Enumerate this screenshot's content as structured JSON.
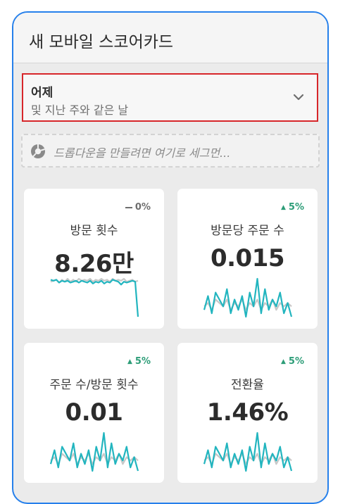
{
  "header": {
    "title": "새 모바일 스코어카드"
  },
  "date_range": {
    "label": "어제",
    "sublabel": "및 지난 주와 같은 날"
  },
  "dropzone": {
    "placeholder": "드롭다운을 만들려면 여기로 세그먼..."
  },
  "colors": {
    "accent": "#2680eb",
    "selection_border": "#d7262a",
    "positive": "#2d9d78",
    "current_series": "#22b5bf",
    "previous_series": "#c8c8c8"
  },
  "metrics": [
    {
      "name": "방문 횟수",
      "value": "8.26만",
      "delta": "0%",
      "trend": "flat",
      "current": [
        8,
        7,
        8,
        5,
        7,
        6,
        7,
        5,
        6,
        7,
        5,
        7,
        6,
        5,
        7,
        4,
        6,
        5,
        7,
        4,
        6,
        5,
        8,
        7,
        6,
        3,
        6,
        5,
        6,
        7,
        6,
        -30
      ],
      "previous": [
        6,
        7,
        8,
        5,
        8,
        6,
        9,
        6,
        8,
        6,
        9,
        7,
        8,
        7,
        9,
        6,
        8,
        7,
        9,
        7,
        8,
        6,
        9,
        7,
        8,
        7,
        9,
        6,
        7,
        8,
        6,
        7
      ]
    },
    {
      "name": "방문당 주문 수",
      "value": "0.015",
      "delta": "5%",
      "trend": "up",
      "current": [
        3,
        7,
        2,
        8,
        6,
        4,
        9,
        2,
        6,
        3,
        7,
        1,
        8,
        4,
        12,
        2,
        9,
        3,
        6,
        4,
        8,
        2,
        5,
        1
      ],
      "previous": [
        4,
        5,
        3,
        6,
        5,
        4,
        6,
        3,
        5,
        4,
        6,
        3,
        5,
        4,
        6,
        3,
        5,
        4,
        6,
        3,
        5,
        4,
        5,
        4
      ]
    },
    {
      "name": "주문 수/방문 횟수",
      "value": "0.01",
      "delta": "5%",
      "trend": "up",
      "current": [
        3,
        7,
        2,
        8,
        6,
        4,
        9,
        2,
        6,
        3,
        7,
        1,
        8,
        4,
        12,
        2,
        9,
        3,
        6,
        4,
        8,
        2,
        5,
        1
      ],
      "previous": [
        4,
        5,
        3,
        6,
        5,
        4,
        6,
        3,
        5,
        4,
        6,
        3,
        5,
        4,
        6,
        3,
        5,
        4,
        6,
        3,
        5,
        4,
        5,
        4
      ]
    },
    {
      "name": "전환율",
      "value": "1.46%",
      "delta": "5%",
      "trend": "up",
      "current": [
        3,
        7,
        2,
        8,
        6,
        4,
        9,
        2,
        6,
        3,
        7,
        1,
        8,
        4,
        12,
        2,
        9,
        3,
        6,
        4,
        8,
        2,
        5,
        1
      ],
      "previous": [
        4,
        5,
        3,
        6,
        5,
        4,
        6,
        3,
        5,
        4,
        6,
        3,
        5,
        4,
        6,
        3,
        5,
        4,
        6,
        3,
        5,
        4,
        5,
        4
      ]
    }
  ]
}
